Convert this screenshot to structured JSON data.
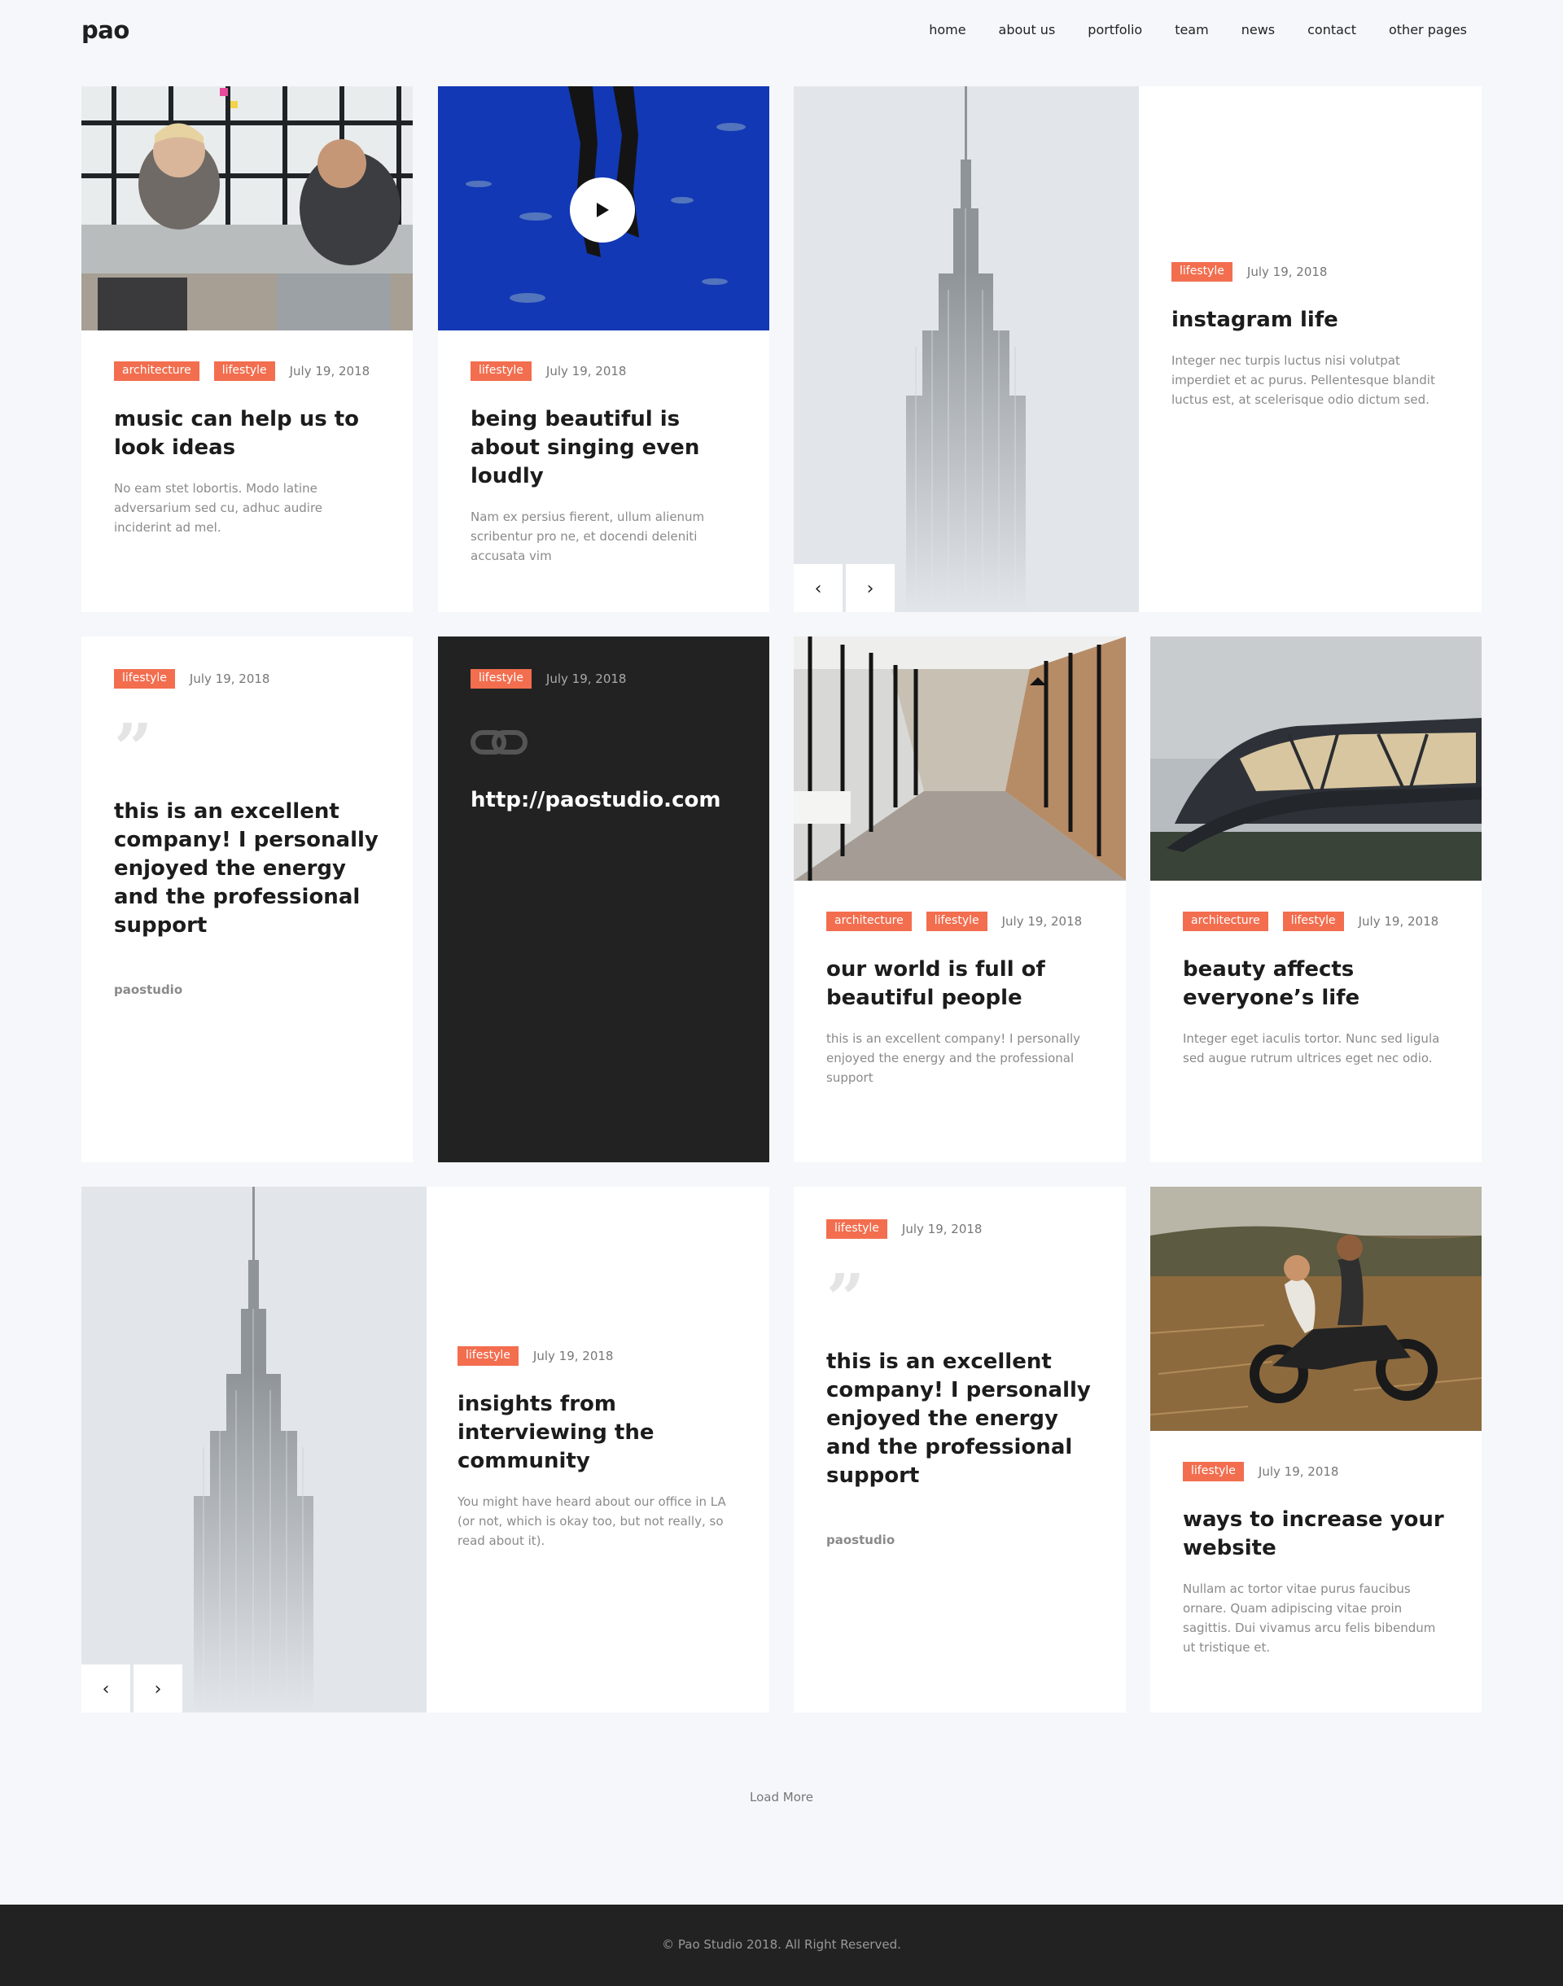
{
  "brand": {
    "logo": "pao"
  },
  "nav": [
    "home",
    "about us",
    "portfolio",
    "team",
    "news",
    "contact",
    "other pages"
  ],
  "colors": {
    "accent": "#f26e4f",
    "dark": "#222222",
    "background": "#f5f7fa"
  },
  "posts": {
    "p1": {
      "tags": [
        "architecture",
        "lifestyle"
      ],
      "date": "July 19, 2018",
      "title": "music can help us to look ideas",
      "excerpt": "No eam stet lobortis. Modo latine adversarium sed cu, adhuc audire inciderint ad mel."
    },
    "p2": {
      "tags": [
        "lifestyle"
      ],
      "date": "July 19, 2018",
      "title": "being beautiful is about singing even loudly",
      "excerpt": "Nam ex persius fierent, ullum alienum scribentur pro ne, et docendi deleniti accusata vim"
    },
    "p3": {
      "tags": [
        "lifestyle"
      ],
      "date": "July 19, 2018",
      "title": "instagram life",
      "excerpt": "Integer nec turpis luctus nisi volutpat imperdiet et ac purus. Pellentesque blandit luctus est, at scelerisque odio dictum sed."
    },
    "p4": {
      "tags": [
        "lifestyle"
      ],
      "date": "July 19, 2018",
      "quote": "this is an excellent company! I personally enjoyed the energy and the professional support",
      "author": "paostudio"
    },
    "p5": {
      "tags": [
        "lifestyle"
      ],
      "date": "July 19, 2018",
      "link": "http://paostudio.com"
    },
    "p6": {
      "tags": [
        "architecture",
        "lifestyle"
      ],
      "date": "July 19, 2018",
      "title": "our world is full of beautiful people",
      "excerpt": "this is an excellent company! I personally enjoyed the energy and the professional support"
    },
    "p7": {
      "tags": [
        "architecture",
        "lifestyle"
      ],
      "date": "July 19, 2018",
      "title": "beauty affects everyone’s life",
      "excerpt": "Integer eget iaculis tortor. Nunc sed ligula sed augue rutrum ultrices eget nec odio."
    },
    "p8": {
      "tags": [
        "lifestyle"
      ],
      "date": "July 19, 2018",
      "title": "insights from interviewing the community",
      "excerpt": "You might have heard about our office in LA (or not, which is okay too, but not really, so read about it)."
    },
    "p9": {
      "tags": [
        "lifestyle"
      ],
      "date": "July 19, 2018",
      "quote": "this is an excellent company! I personally enjoyed the energy and the professional support",
      "author": "paostudio"
    },
    "p10": {
      "tags": [
        "lifestyle"
      ],
      "date": "July 19, 2018",
      "title": "ways to increase your website",
      "excerpt": "Nullam ac tortor vitae purus faucibus ornare. Quam adipiscing vitae proin sagittis. Dui vivamus arcu felis bibendum ut tristique et."
    }
  },
  "slider": {
    "prev": "‹",
    "next": "›"
  },
  "load_more": "Load More",
  "footer": {
    "copyright": "© Pao Studio 2018. All Right Reserved."
  }
}
